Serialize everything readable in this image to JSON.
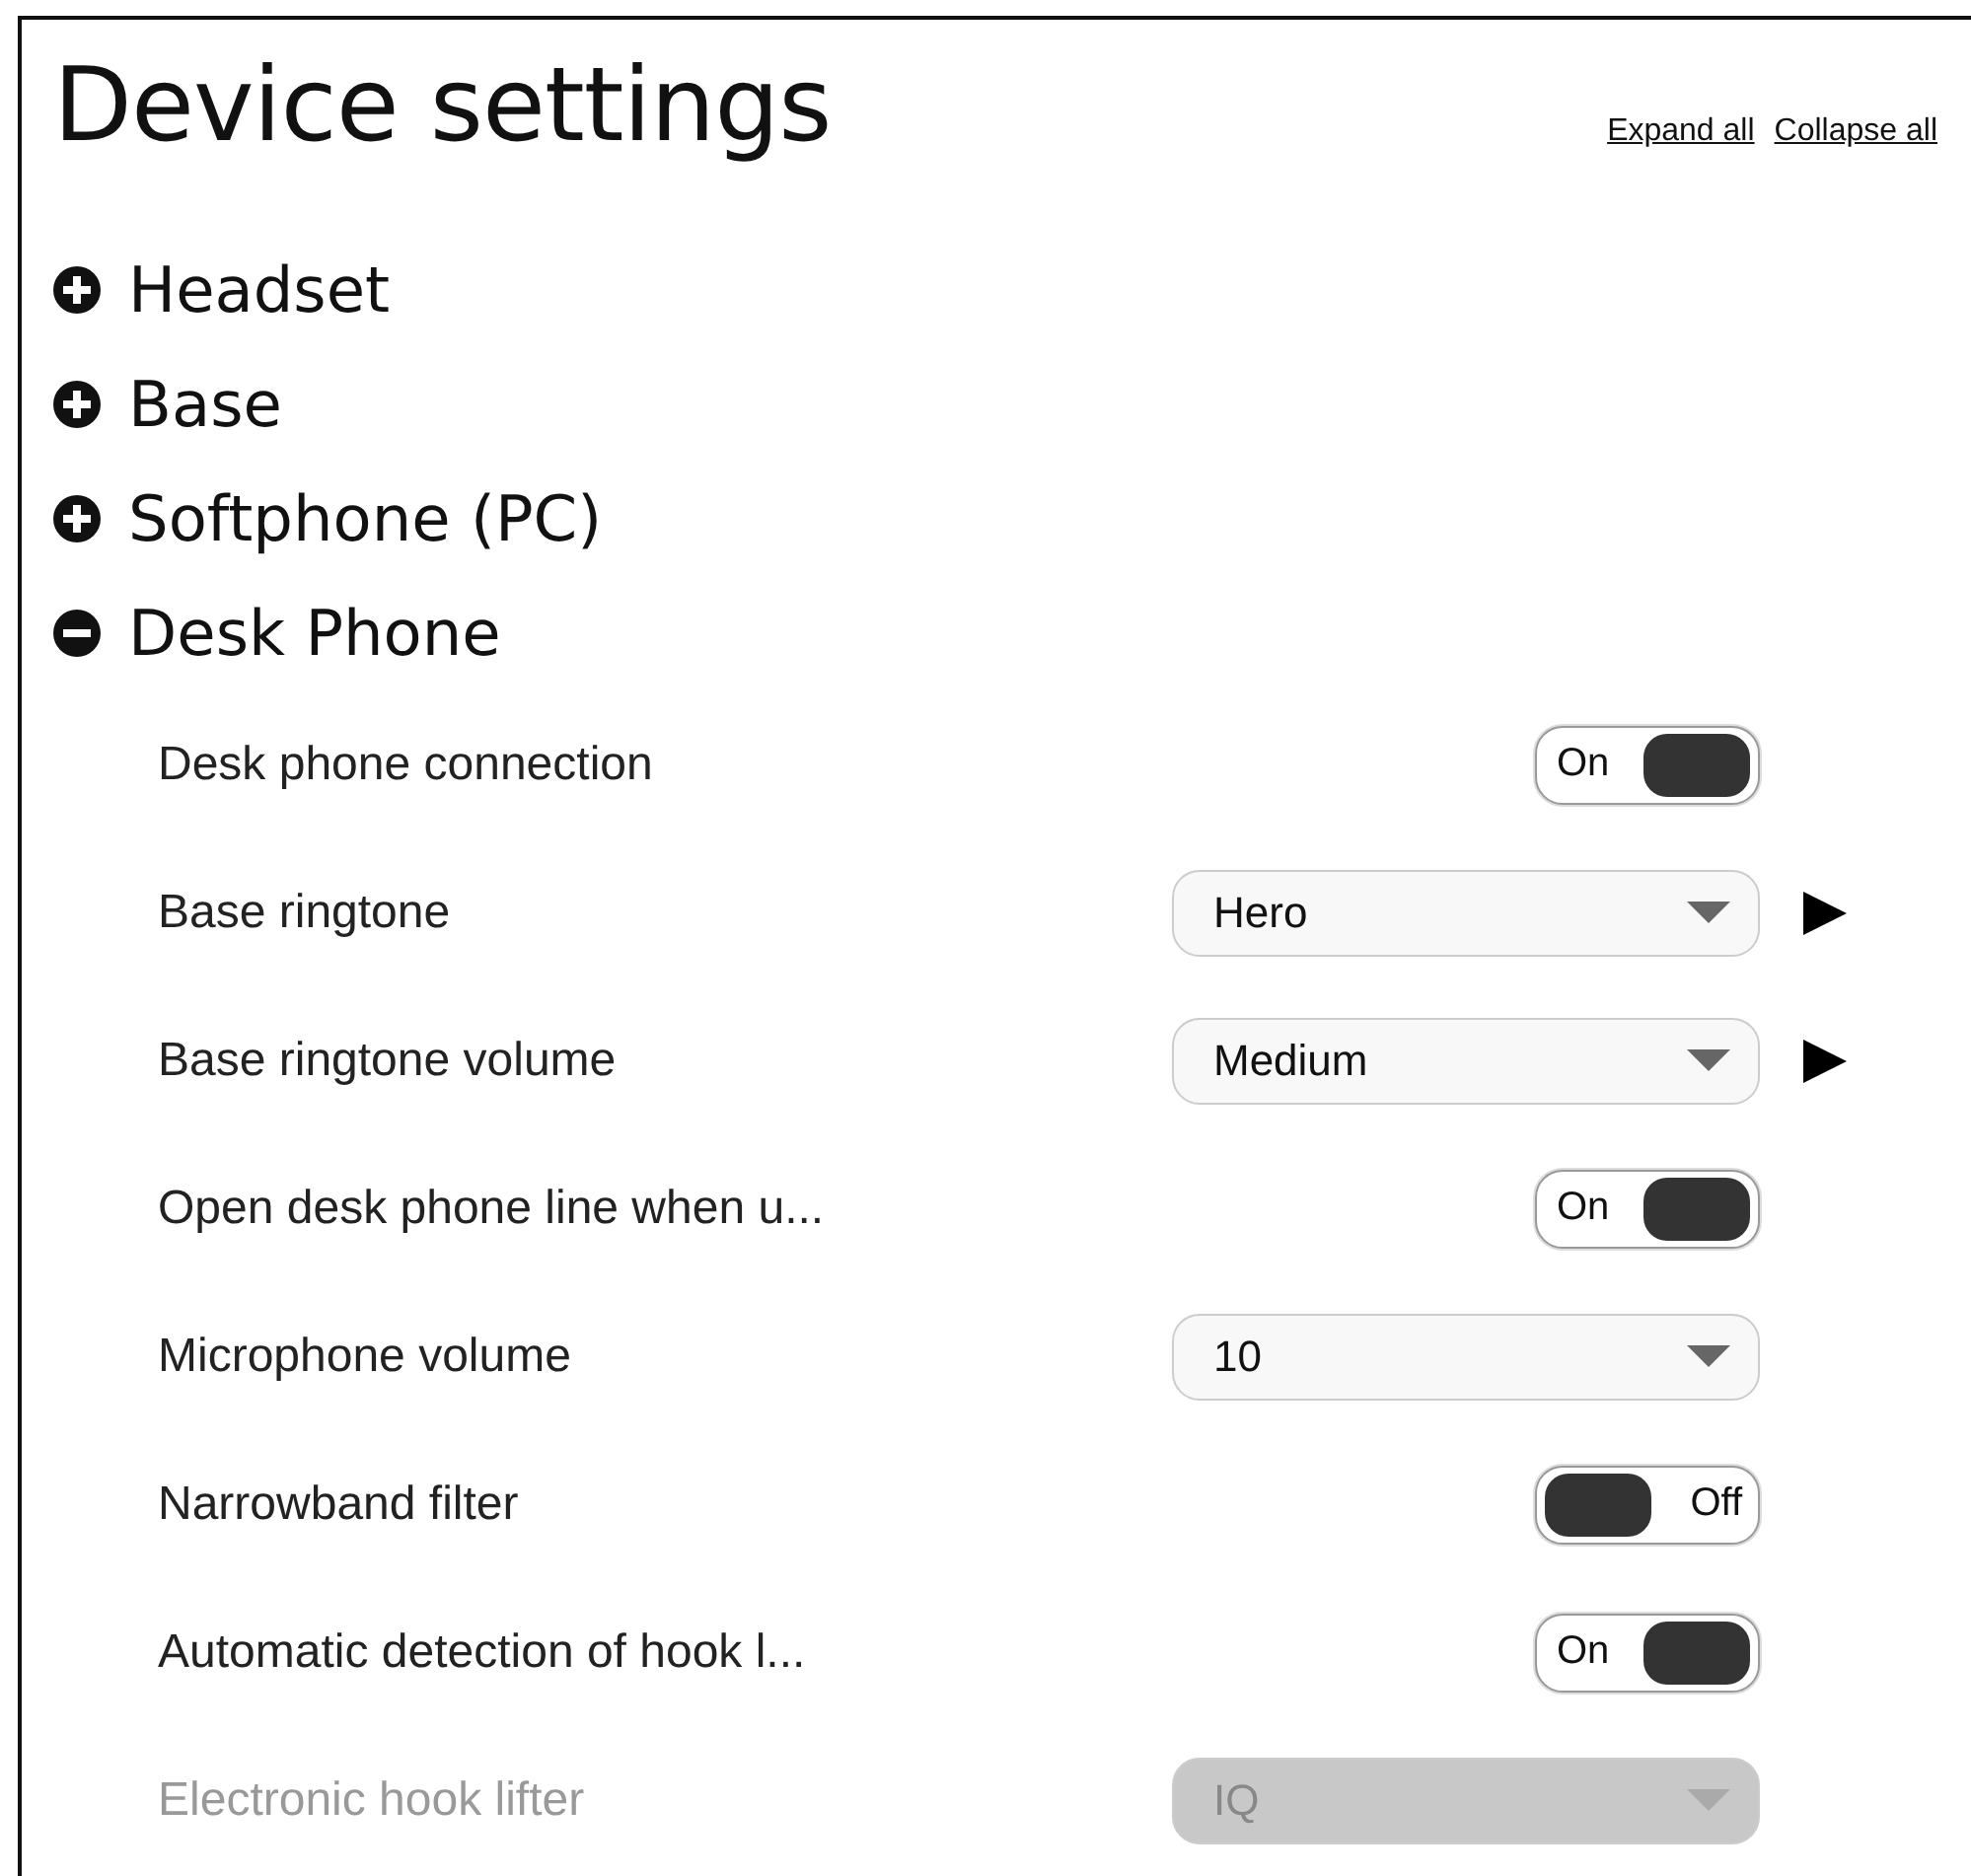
{
  "title": "Device settings",
  "links": [
    "Expand all",
    "Collapse all"
  ],
  "sections": [
    {
      "label": "Headset",
      "expanded": false
    },
    {
      "label": "Base",
      "expanded": false
    },
    {
      "label": "Softphone (PC)",
      "expanded": false
    },
    {
      "label": "Desk Phone",
      "expanded": true,
      "settings": [
        {
          "kind": "toggle",
          "label": "Desk phone connection",
          "on": true,
          "value": "On",
          "disabled": false
        },
        {
          "kind": "select",
          "label": "Base ringtone",
          "value": "Hero",
          "play": true,
          "disabled": false
        },
        {
          "kind": "select",
          "label": "Base ringtone volume",
          "value": "Medium",
          "play": true,
          "disabled": false
        },
        {
          "kind": "toggle",
          "label": "Open desk phone line when u...",
          "on": true,
          "value": "On",
          "disabled": false
        },
        {
          "kind": "select",
          "label": "Microphone volume",
          "value": "10",
          "play": false,
          "disabled": false
        },
        {
          "kind": "toggle",
          "label": "Narrowband filter",
          "on": false,
          "value": "Off",
          "disabled": false
        },
        {
          "kind": "toggle",
          "label": "Automatic detection of hook l...",
          "on": true,
          "value": "On",
          "disabled": false
        },
        {
          "kind": "select",
          "label": "Electronic hook lifter",
          "value": "IQ",
          "play": false,
          "disabled": true
        }
      ]
    }
  ]
}
